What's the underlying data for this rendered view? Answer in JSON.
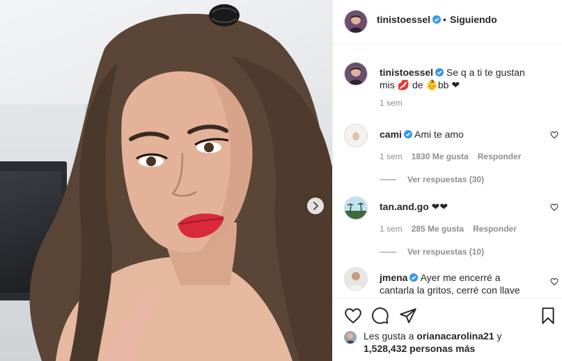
{
  "post": {
    "owner_username": "tinistoessel",
    "follow_status": "Siguiendo",
    "separator": "•",
    "caption": "Se q a ti te gustan mis 💋 de 👶bb ❤",
    "caption_age": "1 sem"
  },
  "comments": [
    {
      "username": "cami",
      "verified": true,
      "text": "Ami te amo",
      "age": "1 sem",
      "likes": "1830 Me gusta",
      "reply_label": "Responder",
      "replies_label": "Ver respuestas (30)"
    },
    {
      "username": "tan.and.go",
      "verified": false,
      "text": "❤❤",
      "age": "1 sem",
      "likes": "285 Me gusta",
      "reply_label": "Responder",
      "replies_label": "Ver respuestas (10)"
    },
    {
      "username": "jmena",
      "verified": true,
      "text": "Ayer me encerré a cantarla la gritos, cerré con llave"
    }
  ],
  "likes_summary": {
    "prefix": "Les gusta a",
    "user": "orianacarolina21",
    "middle": "y",
    "count": "1,528,432 personas más"
  },
  "icons": {
    "like": "heart-icon",
    "comment": "comment-icon",
    "share": "share-icon",
    "save": "bookmark-icon",
    "next": "chevron-right-icon",
    "verified": "verified-badge-icon"
  },
  "colors": {
    "verified": "#3897f0",
    "text": "#262626",
    "muted": "#8e8e8e",
    "lips": "#d8293d"
  }
}
